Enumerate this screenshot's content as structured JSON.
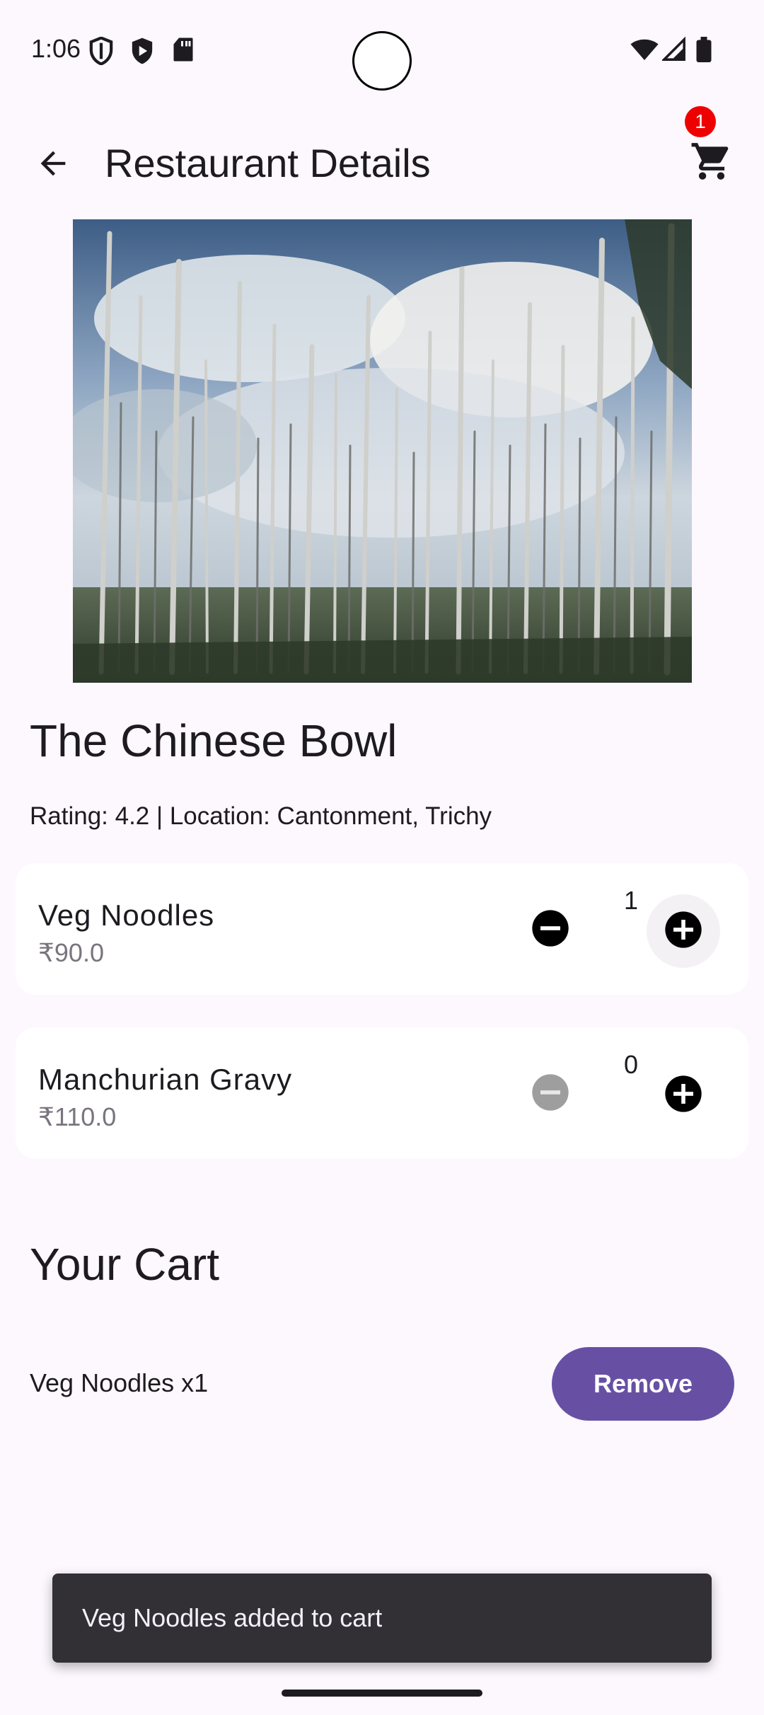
{
  "status_bar": {
    "time": "1:06",
    "icons": [
      "shield-icon",
      "play-shield-icon",
      "sd-card-icon",
      "wifi-icon",
      "signal-icon",
      "battery-icon"
    ]
  },
  "app_bar": {
    "title": "Restaurant Details",
    "cart_count": "1",
    "icons": [
      "arrow-back-icon",
      "cart-icon"
    ]
  },
  "restaurant": {
    "name": "The Chinese Bowl",
    "meta": "Rating: 4.2 | Location: Cantonment, Trichy"
  },
  "menu": {
    "items": [
      {
        "name": "Veg Noodles",
        "price": "₹90.0",
        "quantity": "1"
      },
      {
        "name": "Manchurian Gravy",
        "price": "₹110.0",
        "quantity": "0"
      }
    ]
  },
  "cart": {
    "heading": "Your Cart",
    "line": "Veg Noodles x1",
    "remove_label": "Remove"
  },
  "snackbar": {
    "message": "Veg Noodles added to cart"
  },
  "colors": {
    "background": "#fdf7fe",
    "primary": "#6750a4",
    "badge": "#ee0000",
    "snackbar": "#322f35"
  }
}
